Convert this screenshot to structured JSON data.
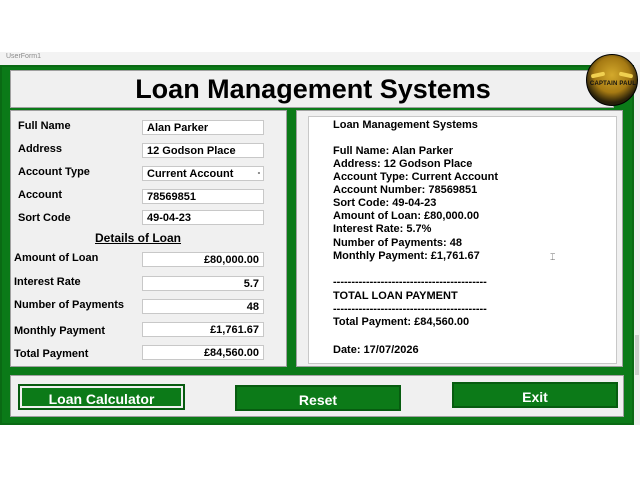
{
  "window": {
    "title": "UserForm1"
  },
  "header": {
    "title": "Loan Management Systems",
    "logo_text": "CAPTAIN PAUL"
  },
  "colors": {
    "form_background": "#0b7a18",
    "button_background": "#0c7a18",
    "panel_background": "#f0f0f0"
  },
  "customer": {
    "full_name_label": "Full Name",
    "full_name": "Alan Parker",
    "address_label": "Address",
    "address": "12 Godson Place",
    "account_type_label": "Account Type",
    "account_type": "Current Account",
    "account_label": "Account",
    "account": "78569851",
    "sort_code_label": "Sort Code",
    "sort_code": "49-04-23"
  },
  "loan": {
    "heading": "Details of Loan",
    "amount_label": "Amount of Loan",
    "amount": "£80,000.00",
    "rate_label": "Interest Rate",
    "rate": "5.7",
    "payments_label": "Number of  Payments",
    "payments": "48",
    "monthly_label": "Monthly Payment",
    "monthly": "£1,761.67",
    "total_label": "Total Payment",
    "total": "£84,560.00"
  },
  "receipt": {
    "lines": [
      "Loan Management Systems",
      "Full Name: Alan Parker",
      "Address: 12 Godson Place",
      "Account Type: Current Account",
      "Account Number: 78569851",
      "Sort Code: 49-04-23",
      "Amount of Loan: £80,000.00",
      "Interest Rate: 5.7%",
      "Number of Payments: 48",
      "Monthly Payment: £1,761.67",
      "------------------------------------------",
      "TOTAL LOAN PAYMENT",
      "------------------------------------------",
      "Total Payment: £84,560.00",
      "Date: 17/07/2026"
    ]
  },
  "buttons": {
    "calculator": "Loan Calculator",
    "reset": "Reset",
    "exit": "Exit"
  }
}
